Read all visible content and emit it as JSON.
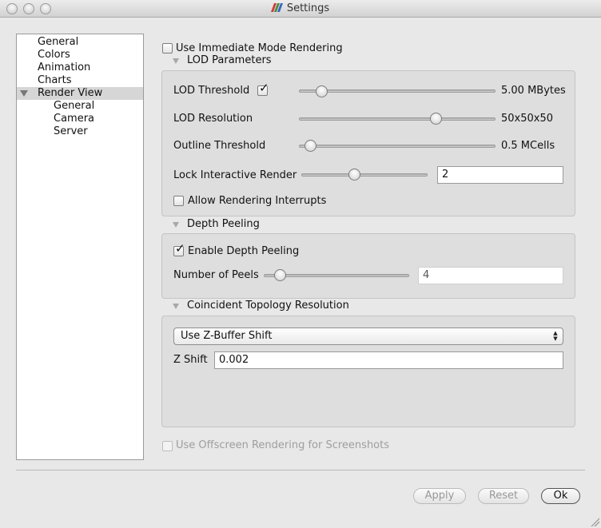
{
  "window": {
    "title": "Settings",
    "logo_colors": [
      "#d23b3b",
      "#4c8d3d",
      "#3a63c4"
    ]
  },
  "sidebar": {
    "items": [
      {
        "label": "General"
      },
      {
        "label": "Colors"
      },
      {
        "label": "Animation"
      },
      {
        "label": "Charts"
      },
      {
        "label": "Render View",
        "expanded": true,
        "selected": true
      },
      {
        "label": "General"
      },
      {
        "label": "Camera"
      },
      {
        "label": "Server"
      }
    ]
  },
  "render_view": {
    "immediate_mode": {
      "label": "Use Immediate Mode Rendering",
      "checked": false
    },
    "lod": {
      "section_title": "LOD Parameters",
      "threshold": {
        "label": "LOD Threshold",
        "checked": true,
        "value_text": "5.00 MBytes",
        "slider_fraction": 0.09
      },
      "resolution": {
        "label": "LOD Resolution",
        "value_text": "50x50x50",
        "slider_fraction": 0.71
      },
      "outline": {
        "label": "Outline Threshold",
        "value_text": "0.5 MCells",
        "slider_fraction": 0.03
      },
      "lock": {
        "label": "Lock Interactive Render",
        "value": "2",
        "slider_fraction": 0.41
      },
      "interrupts": {
        "label": "Allow Rendering Interrupts",
        "checked": false
      }
    },
    "depth_peeling": {
      "section_title": "Depth Peeling",
      "enable": {
        "label": "Enable Depth Peeling",
        "checked": true
      },
      "peels": {
        "label": "Number of Peels",
        "value": "4",
        "slider_fraction": 0.08
      }
    },
    "coincident": {
      "section_title": "Coincident Topology Resolution",
      "mode": "Use Z-Buffer Shift",
      "zshift": {
        "label": "Z Shift",
        "value": "0.002"
      }
    },
    "offscreen": {
      "label": "Use Offscreen Rendering for Screenshots",
      "checked": false
    }
  },
  "buttons": {
    "apply": "Apply",
    "reset": "Reset",
    "ok": "Ok"
  }
}
